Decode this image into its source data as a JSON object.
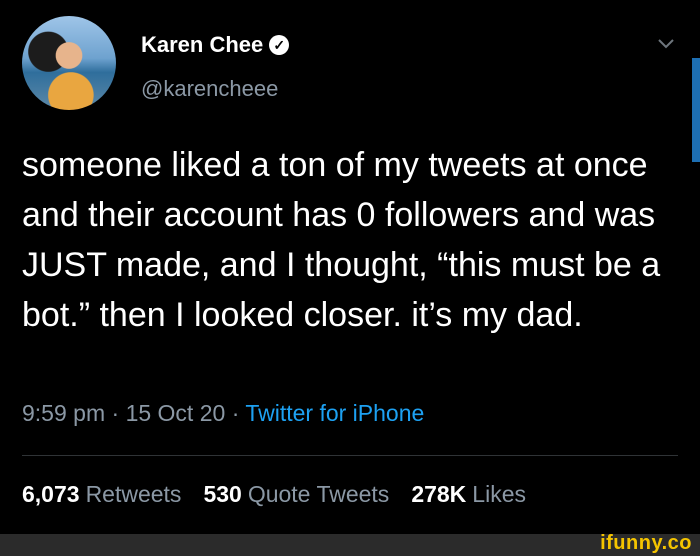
{
  "author": {
    "name": "Karen Chee",
    "handle": "@karencheee"
  },
  "tweet": {
    "text": "someone liked a ton of my tweets at once and their account has 0 followers and was JUST made, and I thought, “this must be a bot.” then I looked closer. it’s my dad.",
    "time": "9:59 pm",
    "date": "15 Oct 20",
    "source": "Twitter for iPhone"
  },
  "stats": {
    "retweets_count": "6,073",
    "retweets_label": "Retweets",
    "quote_count": "530",
    "quote_label": "Quote Tweets",
    "likes_count": "278K",
    "likes_label": "Likes"
  },
  "watermark": "ifunny.co",
  "icons": {
    "verified": "verified-icon",
    "chevron": "chevron-down-icon"
  },
  "colors": {
    "background": "#000000",
    "text": "#ffffff",
    "secondary": "#8b98a5",
    "link": "#1da1f2",
    "watermark": "#f4c400"
  }
}
